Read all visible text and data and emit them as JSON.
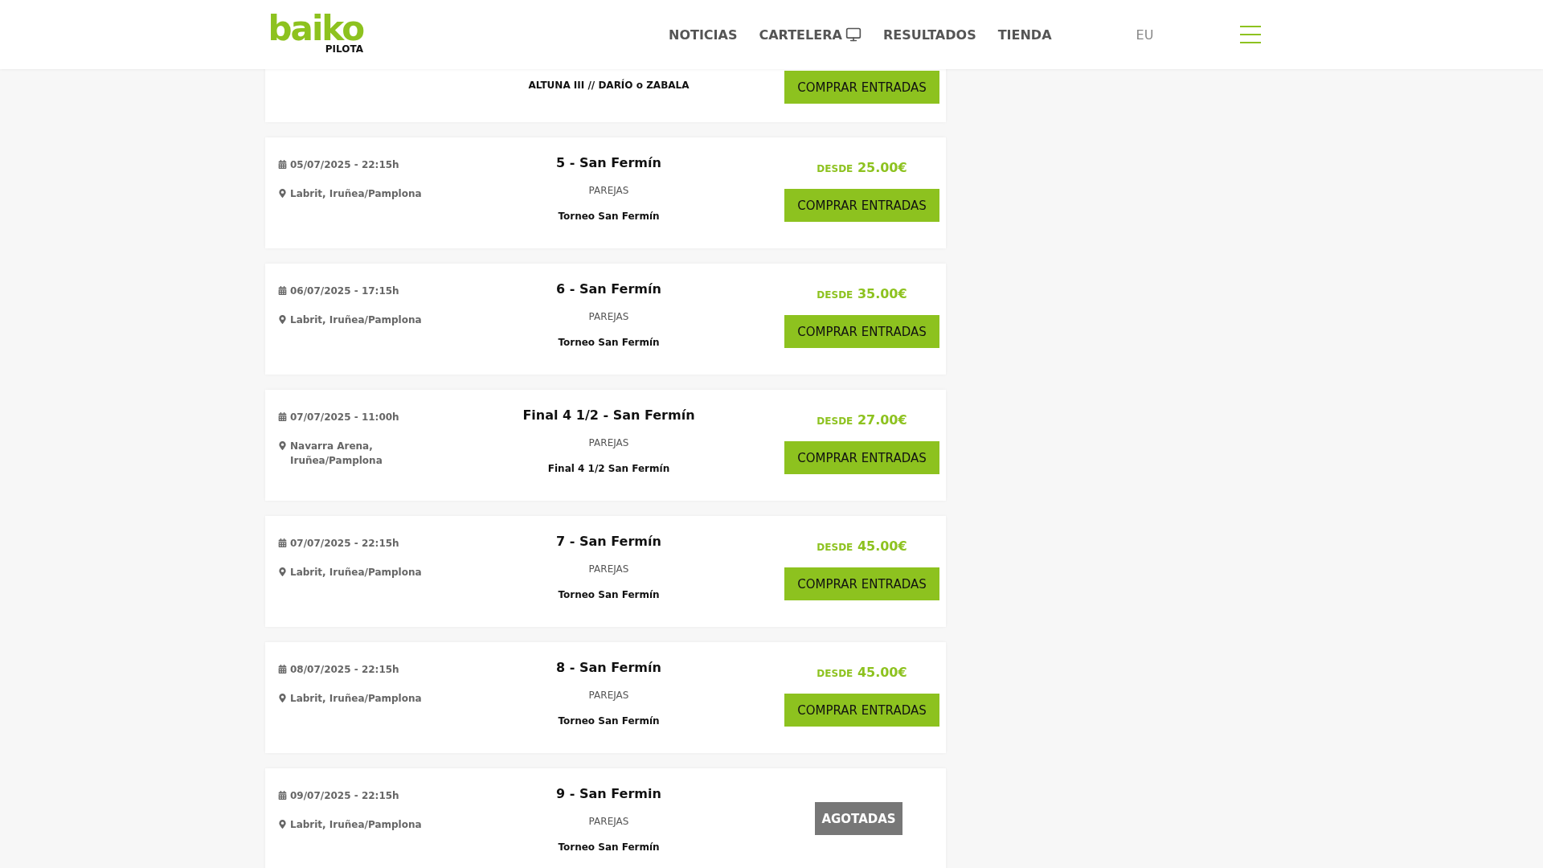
{
  "header": {
    "logo": {
      "wordmark": "baiko",
      "sub": "PILOTA"
    },
    "nav": [
      {
        "label": "NOTICIAS",
        "icon": false
      },
      {
        "label": "CARTELERA",
        "icon": true
      },
      {
        "label": "RESULTADOS",
        "icon": false
      },
      {
        "label": "TIENDA",
        "icon": false
      }
    ],
    "language": "EU"
  },
  "events": [
    {
      "subtitle": "ALTUNA III // DARÍO o ZABALA",
      "action": {
        "kind": "buy",
        "label": "COMPRAR ENTRADAS"
      }
    },
    {
      "date": "05/07/2025 - 22:15h",
      "location": "Labrit, Iruñea/Pamplona",
      "title": "5 - San Fermín",
      "category": "PAREJAS",
      "subtitle": "Torneo San Fermín",
      "price_prefix": "DESDE",
      "price": "25.00€",
      "action": {
        "kind": "buy",
        "label": "COMPRAR ENTRADAS"
      }
    },
    {
      "date": "06/07/2025 - 17:15h",
      "location": "Labrit, Iruñea/Pamplona",
      "title": "6 - San Fermín",
      "category": "PAREJAS",
      "subtitle": "Torneo San Fermín",
      "price_prefix": "DESDE",
      "price": "35.00€",
      "action": {
        "kind": "buy",
        "label": "COMPRAR ENTRADAS"
      }
    },
    {
      "date": "07/07/2025 - 11:00h",
      "location": "Navarra Arena, Iruñea/Pamplona",
      "title": "Final 4 1/2 - San Fermín",
      "category": "PAREJAS",
      "subtitle": "Final 4 1/2 San Fermín",
      "price_prefix": "DESDE",
      "price": "27.00€",
      "action": {
        "kind": "buy",
        "label": "COMPRAR ENTRADAS"
      }
    },
    {
      "date": "07/07/2025 - 22:15h",
      "location": "Labrit, Iruñea/Pamplona",
      "title": "7 - San Fermín",
      "category": "PAREJAS",
      "subtitle": "Torneo San Fermín",
      "price_prefix": "DESDE",
      "price": "45.00€",
      "action": {
        "kind": "buy",
        "label": "COMPRAR ENTRADAS"
      }
    },
    {
      "date": "08/07/2025 - 22:15h",
      "location": "Labrit, Iruñea/Pamplona",
      "title": "8 - San Fermín",
      "category": "PAREJAS",
      "subtitle": "Torneo San Fermín",
      "price_prefix": "DESDE",
      "price": "45.00€",
      "action": {
        "kind": "buy",
        "label": "COMPRAR ENTRADAS"
      }
    },
    {
      "date": "09/07/2025 - 22:15h",
      "location": "Labrit, Iruñea/Pamplona",
      "title": "9 - San Fermin",
      "category": "PAREJAS",
      "subtitle": "Torneo San Fermín",
      "action": {
        "kind": "sold_out",
        "label": "AGOTADAS"
      }
    }
  ]
}
